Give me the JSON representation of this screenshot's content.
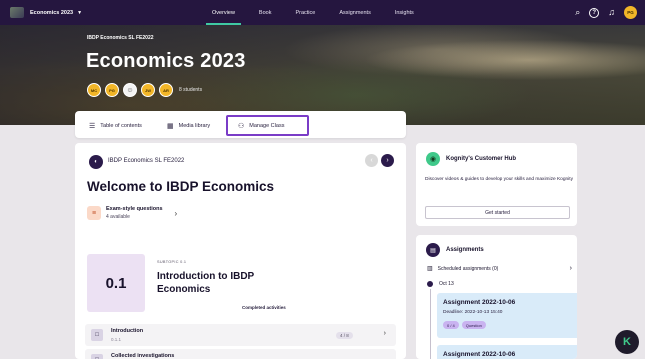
{
  "topnav": {
    "class_name": "Economics 2023",
    "links": [
      "Overview",
      "Book",
      "Practice",
      "Assignments",
      "Insights"
    ],
    "active": "Overview",
    "user_initials": "PG"
  },
  "hero": {
    "subtitle": "IBDP Economics SL FE2022",
    "title": "Economics 2023",
    "members": [
      "MC",
      "PG",
      "",
      "JW",
      "AR"
    ],
    "member_count": "8 students"
  },
  "tabs": {
    "toc": "Table of contents",
    "media": "Media library",
    "manage": "Manage Class"
  },
  "main": {
    "course_code": "IBDP Economics SL FE2022",
    "welcome": "Welcome to IBDP Economics",
    "exam_title": "Exam-style questions",
    "exam_sub": "4 available",
    "subtopic_number": "0.1",
    "subtopic_label": "SUBTOPIC 0.1",
    "subtopic_title": "Introduction to IBDP Economics",
    "completed_label": "Completed activities",
    "rows": [
      {
        "title": "Introduction",
        "code": "0.1.1",
        "count": "4 / 8"
      },
      {
        "title": "Collected investigations",
        "code": "",
        "count": ""
      }
    ]
  },
  "hub": {
    "title": "Kognity's Customer Hub",
    "desc": "Discover videos & guides to develop your skills and maximize Kognity",
    "button": "Get started"
  },
  "assignments": {
    "title": "Assignments",
    "scheduled": "Scheduled assignments (0)",
    "date": "Oct 13",
    "items": [
      {
        "title": "Assignment 2022-10-06",
        "deadline": "Deadline: 2022-10-13 15:40",
        "tag1": "0 / 4",
        "tag2": "Question"
      },
      {
        "title": "Assignment 2022-10-06"
      }
    ]
  },
  "colors": {
    "nav": "#25163f",
    "accent": "#3fc9a3",
    "highlight": "#7a3cc7",
    "avatar": "#f2b628"
  }
}
